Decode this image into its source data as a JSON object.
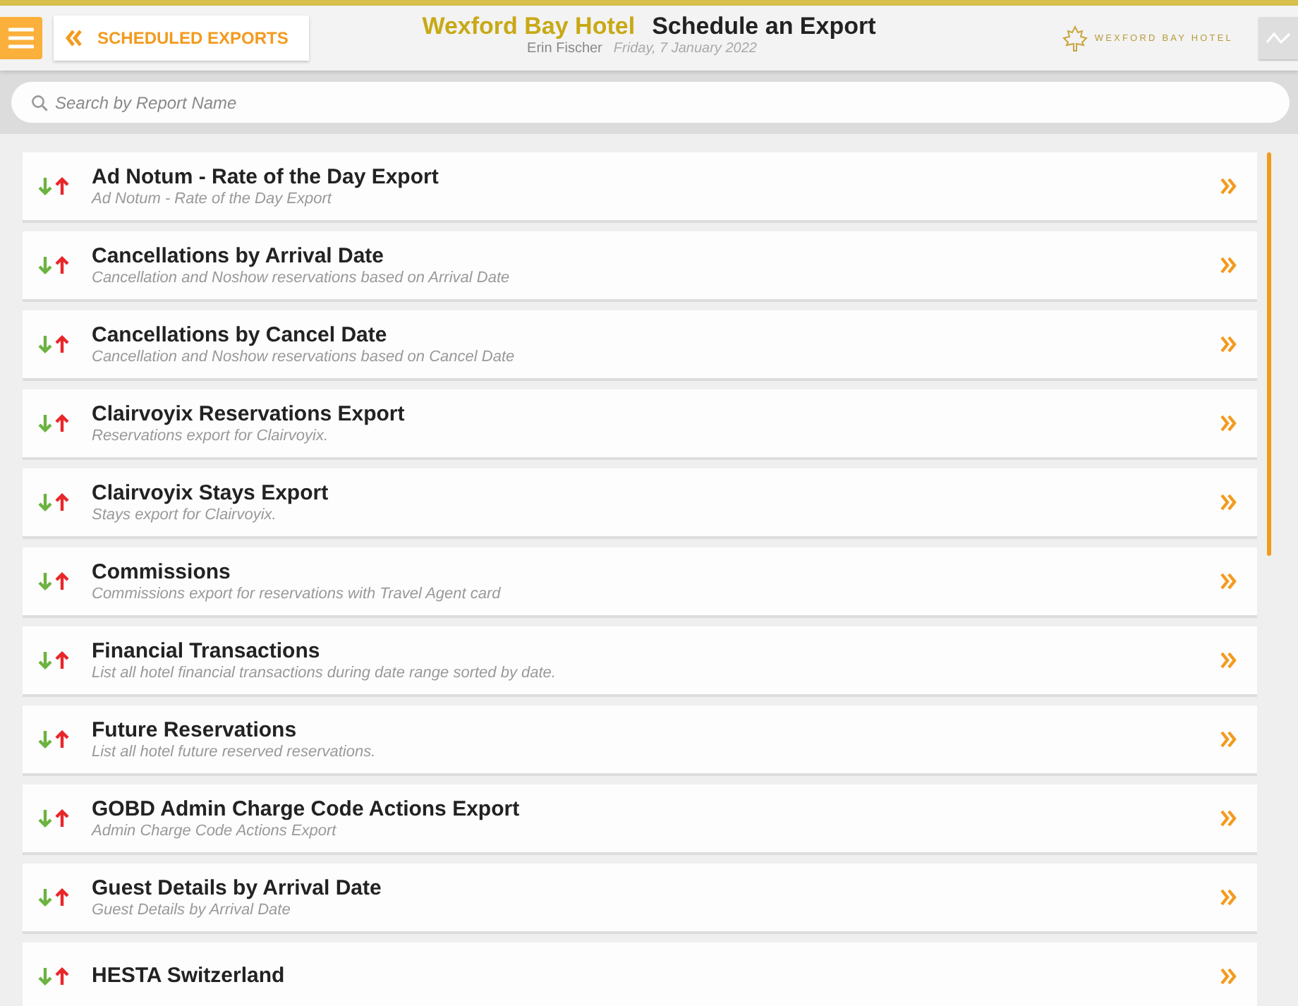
{
  "header": {
    "back_button": "SCHEDULED EXPORTS",
    "hotel": "Wexford Bay Hotel",
    "title": "Schedule an Export",
    "user": "Erin Fischer",
    "date": "Friday, 7 January 2022",
    "logo_text": "WEXFORD BAY HOTEL"
  },
  "search": {
    "placeholder": "Search by Report Name"
  },
  "reports": [
    {
      "title": "Ad Notum - Rate of the Day Export",
      "description": "Ad Notum - Rate of the Day Export"
    },
    {
      "title": "Cancellations by Arrival Date",
      "description": "Cancellation and Noshow reservations based on Arrival Date"
    },
    {
      "title": "Cancellations by Cancel Date",
      "description": "Cancellation and Noshow reservations based on Cancel Date"
    },
    {
      "title": "Clairvoyix Reservations Export",
      "description": "Reservations export for Clairvoyix."
    },
    {
      "title": "Clairvoyix Stays Export",
      "description": "Stays export for Clairvoyix."
    },
    {
      "title": "Commissions",
      "description": "Commissions export for reservations with Travel Agent card"
    },
    {
      "title": "Financial Transactions",
      "description": "List all hotel financial transactions during date range sorted by date."
    },
    {
      "title": "Future Reservations",
      "description": "List all hotel future reserved reservations."
    },
    {
      "title": "GOBD Admin Charge Code Actions Export",
      "description": "Admin Charge Code Actions Export"
    },
    {
      "title": "Guest Details by Arrival Date",
      "description": "Guest Details by Arrival Date"
    },
    {
      "title": "HESTA Switzerland"
    }
  ]
}
